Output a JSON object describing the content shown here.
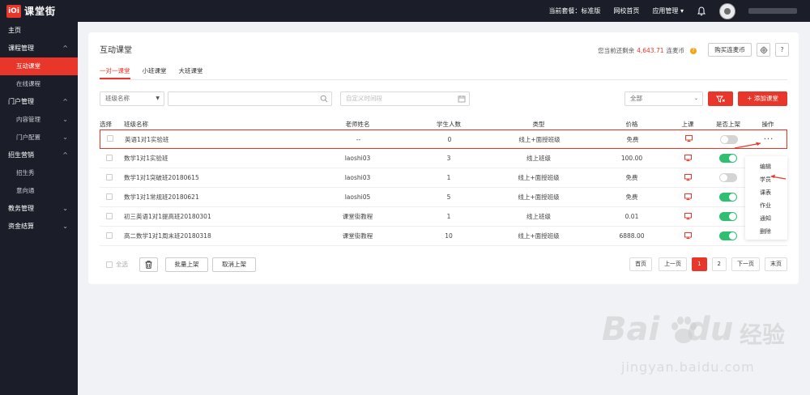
{
  "app": {
    "logo_mark": "iOi",
    "logo_text": "课堂街"
  },
  "topbar": {
    "plan": "当前套餐：标准版",
    "school_home": "网校首页",
    "app_manage": "应用管理",
    "app_manage_caret": "▾"
  },
  "sidebar": {
    "items": [
      {
        "label": "主页",
        "type": "section",
        "chev": ""
      },
      {
        "label": "课程管理",
        "type": "section",
        "chev": "^"
      },
      {
        "label": "互动课堂",
        "type": "item",
        "active": true,
        "chev": ""
      },
      {
        "label": "在线课程",
        "type": "item",
        "chev": ""
      },
      {
        "label": "门户管理",
        "type": "section",
        "chev": "^"
      },
      {
        "label": "内容管理",
        "type": "item",
        "chev": "⌄"
      },
      {
        "label": "门户配置",
        "type": "item",
        "chev": "⌄"
      },
      {
        "label": "招生营销",
        "type": "section",
        "chev": "^"
      },
      {
        "label": "招生秀",
        "type": "item",
        "chev": ""
      },
      {
        "label": "意向通",
        "type": "item",
        "chev": ""
      },
      {
        "label": "教务管理",
        "type": "section",
        "chev": "⌄"
      },
      {
        "label": "资金结算",
        "type": "section",
        "chev": "⌄"
      }
    ]
  },
  "page": {
    "title": "互动课堂",
    "balance_prefix": "您当前还剩余",
    "balance_amount": "4,643.71",
    "balance_unit": "连麦币",
    "buy_button": "购买连麦币",
    "help_button": "?"
  },
  "tabs": [
    "一对一课堂",
    "小班课堂",
    "大班课堂"
  ],
  "filters": {
    "class_name_select": "班级名称",
    "date_placeholder": "自定义时间段",
    "status_select": "全部",
    "add_button": "+ 添加课堂"
  },
  "table": {
    "headers": [
      "选择",
      "班级名称",
      "老师姓名",
      "学生人数",
      "类型",
      "价格",
      "上课",
      "是否上架",
      "操作"
    ],
    "rows": [
      {
        "name": "英语1对1实验班",
        "teacher": "--",
        "count": "0",
        "type": "线上+面授班级",
        "price": "免费",
        "listed": false,
        "op": "···"
      },
      {
        "name": "数学1对1实验班",
        "teacher": "laoshi03",
        "count": "3",
        "type": "线上班级",
        "price": "100.00",
        "listed": true,
        "op": ""
      },
      {
        "name": "数学1对1突破班20180615",
        "teacher": "laoshi03",
        "count": "1",
        "type": "线上+面授班级",
        "price": "免费",
        "listed": false,
        "op": ""
      },
      {
        "name": "数学1对1常规班20180621",
        "teacher": "laoshi05",
        "count": "5",
        "type": "线上+面授班级",
        "price": "免费",
        "listed": true,
        "op": ""
      },
      {
        "name": "初三英语1对1提高班20180301",
        "teacher": "课堂街教程",
        "count": "1",
        "type": "线上班级",
        "price": "0.01",
        "listed": true,
        "op": ""
      },
      {
        "name": "高二数学1对1周末班20180318",
        "teacher": "课堂街教程",
        "count": "10",
        "type": "线上+面授班级",
        "price": "6888.00",
        "listed": true,
        "op": ""
      }
    ]
  },
  "bottom": {
    "select_all": "全选",
    "batch_list": "批量上架",
    "cancel_list": "取消上架"
  },
  "pager": {
    "first": "首页",
    "prev": "上一页",
    "pages": [
      "1",
      "2"
    ],
    "next": "下一页",
    "last": "末页"
  },
  "dropdown": {
    "items": [
      "编辑",
      "学员",
      "课表",
      "作业",
      "通知",
      "删除"
    ]
  },
  "watermark": {
    "brand": "Bai",
    "brand_tail": "du",
    "cn": "经验",
    "url": "jingyan.baidu.com"
  },
  "colors": {
    "accent": "#e8372a",
    "sidebar_bg": "#1b1e29",
    "toggle_on": "#2fbf71"
  }
}
